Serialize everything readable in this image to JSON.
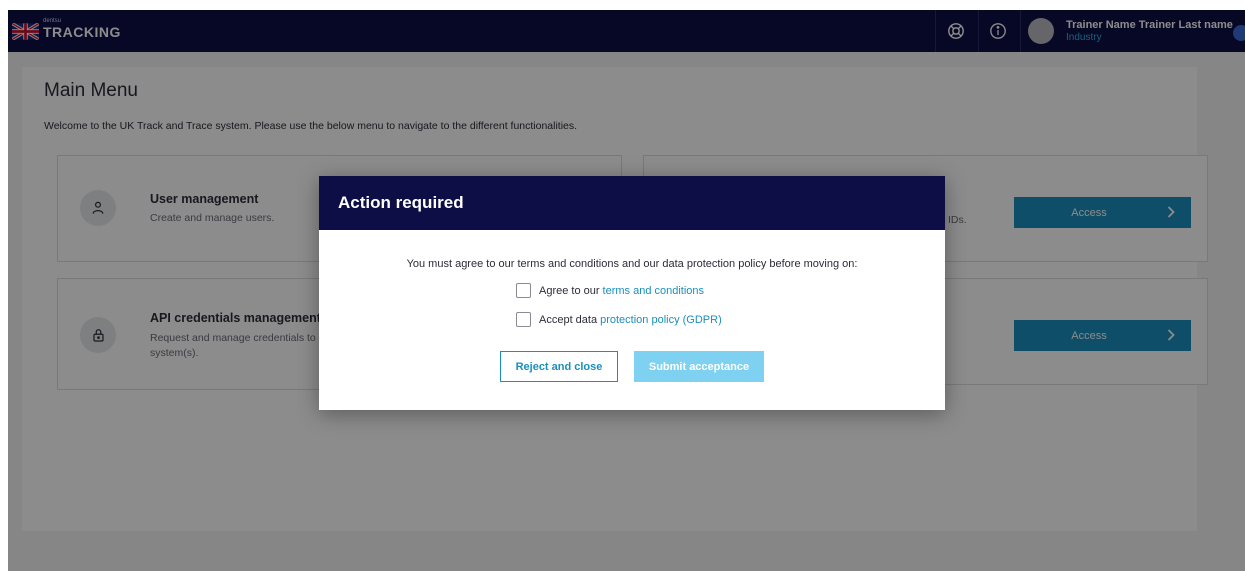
{
  "header": {
    "brand_small": "dentsu",
    "brand_title": "TRACKING",
    "user_name": "Trainer Name Trainer Last name",
    "user_role": "Industry",
    "icons": [
      "uk-flag-icon",
      "help-lifebuoy-icon",
      "info-icon",
      "avatar",
      "chevron-down-icon"
    ]
  },
  "main": {
    "title": "Main Menu",
    "welcome": "Welcome to the UK Track and Trace system. Please use the below menu to navigate to the different functionalities.",
    "cards": [
      {
        "title": "User management",
        "description": "Create and manage users.",
        "icon": "users-icon"
      },
      {
        "title": "API credentials management",
        "description_line1": "Request and manage credentials to",
        "description_line2": "system(s).",
        "icon": "lock-icon"
      },
      {
        "partial_text": "IDs.",
        "access_label": "Access"
      },
      {
        "access_label": "Access"
      }
    ]
  },
  "modal": {
    "title": "Action required",
    "message": "You must agree to our terms and conditions and our data protection policy before moving on:",
    "checkbox1_prefix": "Agree to our",
    "checkbox1_link": "terms and conditions",
    "checkbox2_prefix": "Accept data",
    "checkbox2_link": "protection policy (GDPR)",
    "reject_label": "Reject and close",
    "submit_label": "Submit acceptance"
  },
  "colors": {
    "navy": "#0d0e45",
    "accent": "#1a8fbd",
    "submit_disabled": "#7fd1f2",
    "link": "#1a8fbd"
  }
}
